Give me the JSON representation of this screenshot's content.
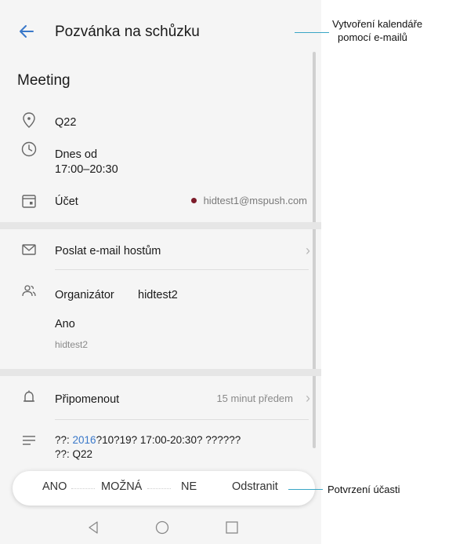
{
  "header": {
    "title": "Pozvánka na schůzku"
  },
  "event": {
    "title": "Meeting",
    "location": "Q22",
    "time_line1": "Dnes od",
    "time_line2": "17:00–20:30",
    "account_label": "Účet",
    "account_email": "hidtest1@mspush.com",
    "account_color": "#7d1c2a"
  },
  "guests": {
    "send_email_label": "Poslat e-mail hostům",
    "organizer_label": "Organizátor",
    "organizer_name": "hidtest2",
    "status": "Ano",
    "attendee": "hidtest2"
  },
  "reminder": {
    "label": "Připomenout",
    "value": "15 minut předem"
  },
  "description": {
    "part1": "??: ",
    "year": "2016",
    "part2": "?10?19? 17:00-20:30? ??????",
    "line2": "??: Q22"
  },
  "actions": {
    "yes": "ANO",
    "maybe": "MOŽNÁ",
    "no": "NE",
    "delete": "Odstranit"
  },
  "callouts": {
    "top_line1": "Vytvoření kalendáře",
    "top_line2": "pomocí e-mailů",
    "bottom": "Potvrzení účasti",
    "line_color": "#3aa6c5"
  },
  "icons": {
    "back": "back-arrow-icon",
    "location": "location-pin-icon",
    "time": "clock-icon",
    "account": "calendar-icon",
    "email": "envelope-icon",
    "organizer": "people-icon",
    "reminder": "bell-icon",
    "description": "notes-icon",
    "nav_back": "nav-back-icon",
    "nav_home": "nav-home-icon",
    "nav_recent": "nav-recent-icon"
  }
}
